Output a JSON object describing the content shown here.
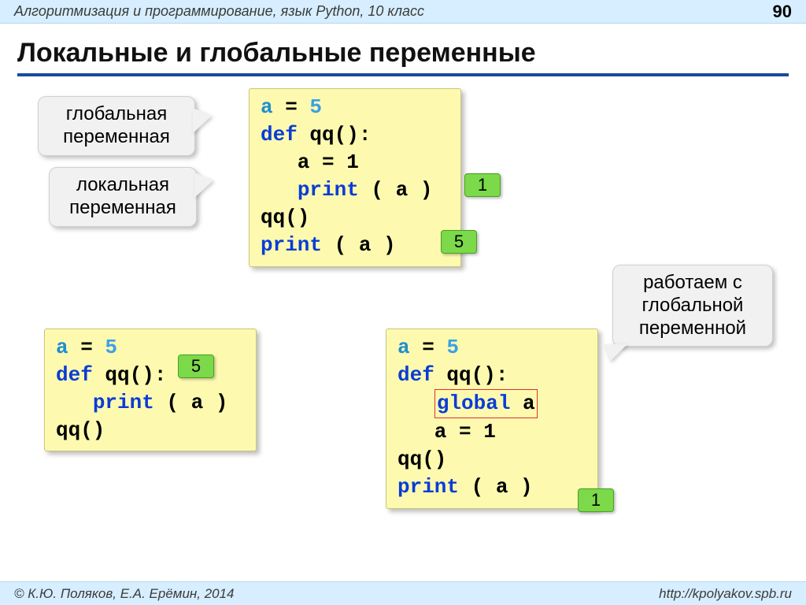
{
  "header": {
    "course": "Алгоритмизация и программирование, язык Python, 10 класс",
    "page": "90"
  },
  "title": "Локальные и глобальные переменные",
  "callouts": {
    "global": "глобальная\nпеременная",
    "local": "локальная\nпеременная",
    "workglobal": "работаем с\nглобальной\nпеременной"
  },
  "code1": {
    "l1a": "a",
    "l1b": " = ",
    "l1c": "5",
    "l2a": "def",
    "l2b": " qq():",
    "l3": "   a = 1",
    "l4a": "   ",
    "l4b": "print",
    "l4c": " ( a )",
    "l5": "qq()",
    "l6a": "print",
    "l6b": " ( a )"
  },
  "labels": {
    "r1": "1",
    "r2": "5",
    "r3": "5",
    "r4": "1"
  },
  "code2": {
    "l1a": "a",
    "l1b": " = ",
    "l1c": "5",
    "l2a": "def",
    "l2b": " qq():",
    "l3a": "   ",
    "l3b": "print",
    "l3c": " ( a )",
    "l4": "qq()"
  },
  "code3": {
    "l1a": "a",
    "l1b": " = ",
    "l1c": "5",
    "l2a": "def",
    "l2b": " qq():",
    "l3a": "   ",
    "l3b": "global",
    "l3c": " a",
    "l4": "   a = 1",
    "l5": "qq()",
    "l6a": "print",
    "l6b": " ( a )"
  },
  "footer": {
    "authors": "© К.Ю. Поляков, Е.А. Ерёмин, 2014",
    "url": "http://kpolyakov.spb.ru"
  }
}
